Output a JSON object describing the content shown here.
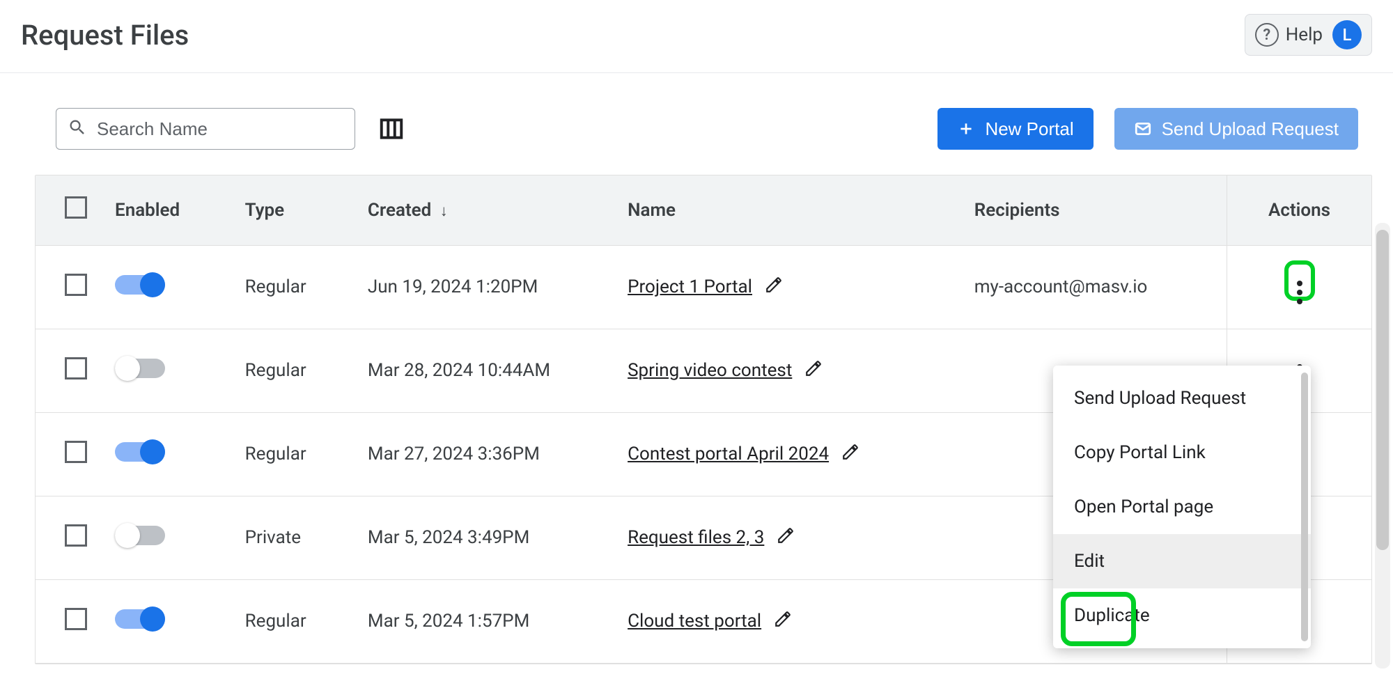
{
  "header": {
    "title": "Request Files",
    "help_label": "Help",
    "avatar_initial": "L"
  },
  "toolbar": {
    "search_placeholder": "Search Name",
    "new_portal_label": "New Portal",
    "send_request_label": "Send Upload Request"
  },
  "table": {
    "headers": {
      "enabled": "Enabled",
      "type": "Type",
      "created": "Created",
      "name": "Name",
      "recipients": "Recipients",
      "actions": "Actions"
    },
    "rows": [
      {
        "enabled": true,
        "type": "Regular",
        "created": "Jun 19, 2024 1:20PM",
        "name": "Project 1 Portal",
        "recipients": "my-account@masv.io"
      },
      {
        "enabled": false,
        "type": "Regular",
        "created": "Mar 28, 2024 10:44AM",
        "name": "Spring video contest",
        "recipients": ""
      },
      {
        "enabled": true,
        "type": "Regular",
        "created": "Mar 27, 2024 3:36PM",
        "name": "Contest portal April 2024",
        "recipients": ""
      },
      {
        "enabled": false,
        "type": "Private",
        "created": "Mar 5, 2024 3:49PM",
        "name": "Request files 2, 3",
        "recipients": ""
      },
      {
        "enabled": true,
        "type": "Regular",
        "created": "Mar 5, 2024 1:57PM",
        "name": "Cloud test portal",
        "recipients": ""
      }
    ]
  },
  "context_menu": {
    "items": [
      "Send Upload Request",
      "Copy Portal Link",
      "Open Portal page",
      "Edit",
      "Duplicate"
    ]
  }
}
